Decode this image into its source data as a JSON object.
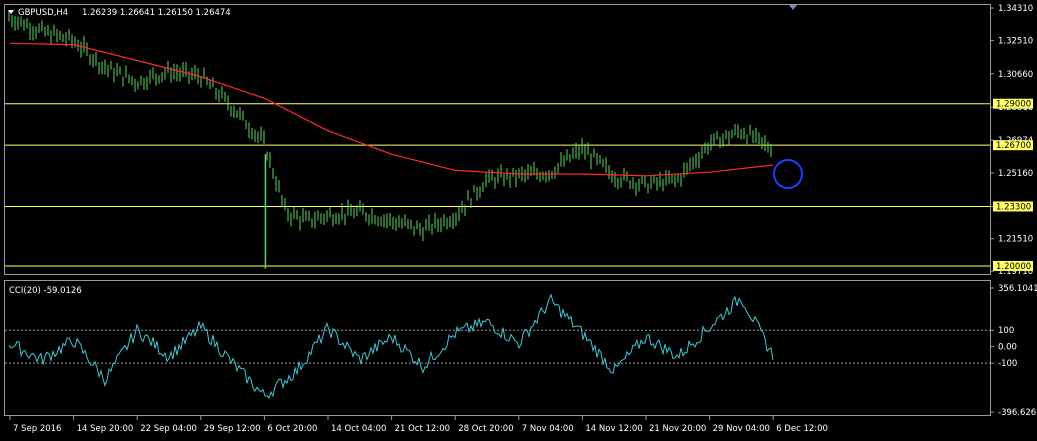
{
  "header": {
    "symbol": "GBPUSD,H4",
    "ohlc": "1.26239 1.26641 1.26150 1.26474"
  },
  "indicator": {
    "label": "CCI(20) -59.0126"
  },
  "colors": {
    "background": "#000000",
    "candles": "#5cd65c",
    "moving_average": "#ff2a2a",
    "levels": "#ffff66",
    "cci": "#3fc7d0",
    "grid": "#9a9a9a",
    "marker": "#1e3dff"
  },
  "chart_data": [
    {
      "type": "line",
      "name": "GBPUSD H4 price",
      "y_range": [
        1.1972,
        1.3431
      ],
      "x_ticks": [
        "7 Sep 2016",
        "14 Sep 20:00",
        "22 Sep 04:00",
        "29 Sep 12:00",
        "6 Oct 20:00",
        "14 Oct 04:00",
        "21 Oct 12:00",
        "28 Oct 20:00",
        "7 Nov 04:00",
        "14 Nov 12:00",
        "21 Nov 20:00",
        "29 Nov 04:00",
        "6 Dec 12:00"
      ],
      "y_ticks": [
        "1.34310",
        "1.32510",
        "1.30660",
        "1.28810",
        "1.26974",
        "1.25160",
        "1.23300",
        "1.21510",
        "1.19710"
      ],
      "horizontal_levels": [
        "1.29000",
        "1.26700",
        "1.23300",
        "1.20000"
      ],
      "series": [
        {
          "name": "close",
          "x": [
            "7 Sep 2016",
            "10 Sep",
            "14 Sep 20:00",
            "18 Sep",
            "22 Sep 04:00",
            "25 Sep",
            "29 Sep 12:00",
            "3 Oct",
            "6 Oct 20:00",
            "7 Oct",
            "10 Oct",
            "14 Oct 04:00",
            "18 Oct",
            "21 Oct 12:00",
            "25 Oct",
            "28 Oct 20:00",
            "1 Nov",
            "7 Nov 04:00",
            "10 Nov",
            "14 Nov 12:00",
            "16 Nov",
            "21 Nov 20:00",
            "25 Nov",
            "29 Nov 04:00",
            "2 Dec",
            "6 Dec 12:00"
          ],
          "y": [
            1.338,
            1.33,
            1.325,
            1.31,
            1.302,
            1.308,
            1.305,
            1.288,
            1.268,
            1.23,
            1.225,
            1.228,
            1.23,
            1.225,
            1.22,
            1.228,
            1.248,
            1.25,
            1.252,
            1.265,
            1.25,
            1.245,
            1.248,
            1.268,
            1.275,
            1.2647
          ]
        },
        {
          "name": "moving average",
          "x": [
            "7 Sep 2016",
            "14 Sep 20:00",
            "22 Sep 04:00",
            "29 Sep 12:00",
            "6 Oct 20:00",
            "14 Oct 04:00",
            "21 Oct 12:00",
            "28 Oct 20:00",
            "7 Nov 04:00",
            "14 Nov 12:00",
            "21 Nov 20:00",
            "29 Nov 04:00",
            "6 Dec 12:00"
          ],
          "y": [
            1.3235,
            1.3228,
            1.314,
            1.305,
            1.293,
            1.275,
            1.262,
            1.253,
            1.251,
            1.251,
            1.25,
            1.252,
            1.256
          ]
        }
      ]
    },
    {
      "type": "line",
      "name": "CCI(20)",
      "y_range": [
        -396.6265,
        356.1041
      ],
      "y_ticks": [
        "356.1041",
        "100",
        "0.00",
        "-100",
        "-396.6265"
      ],
      "reference_levels": [
        100,
        -100
      ],
      "series": [
        {
          "name": "CCI",
          "x": [
            "7 Sep 2016",
            "10 Sep",
            "14 Sep 20:00",
            "18 Sep",
            "22 Sep 04:00",
            "25 Sep",
            "29 Sep 12:00",
            "3 Oct",
            "6 Oct 20:00",
            "9 Oct",
            "14 Oct 04:00",
            "17 Oct",
            "21 Oct 12:00",
            "25 Oct",
            "28 Oct 20:00",
            "2 Nov",
            "7 Nov 04:00",
            "10 Nov",
            "14 Nov 12:00",
            "17 Nov",
            "21 Nov 20:00",
            "25 Nov",
            "29 Nov 04:00",
            "2 Dec",
            "6 Dec 12:00"
          ],
          "y": [
            20,
            -80,
            40,
            -200,
            100,
            -60,
            120,
            -100,
            -300,
            -150,
            110,
            -80,
            60,
            -120,
            80,
            150,
            20,
            280,
            80,
            -150,
            60,
            -60,
            120,
            300,
            -59.0126
          ]
        }
      ]
    }
  ]
}
